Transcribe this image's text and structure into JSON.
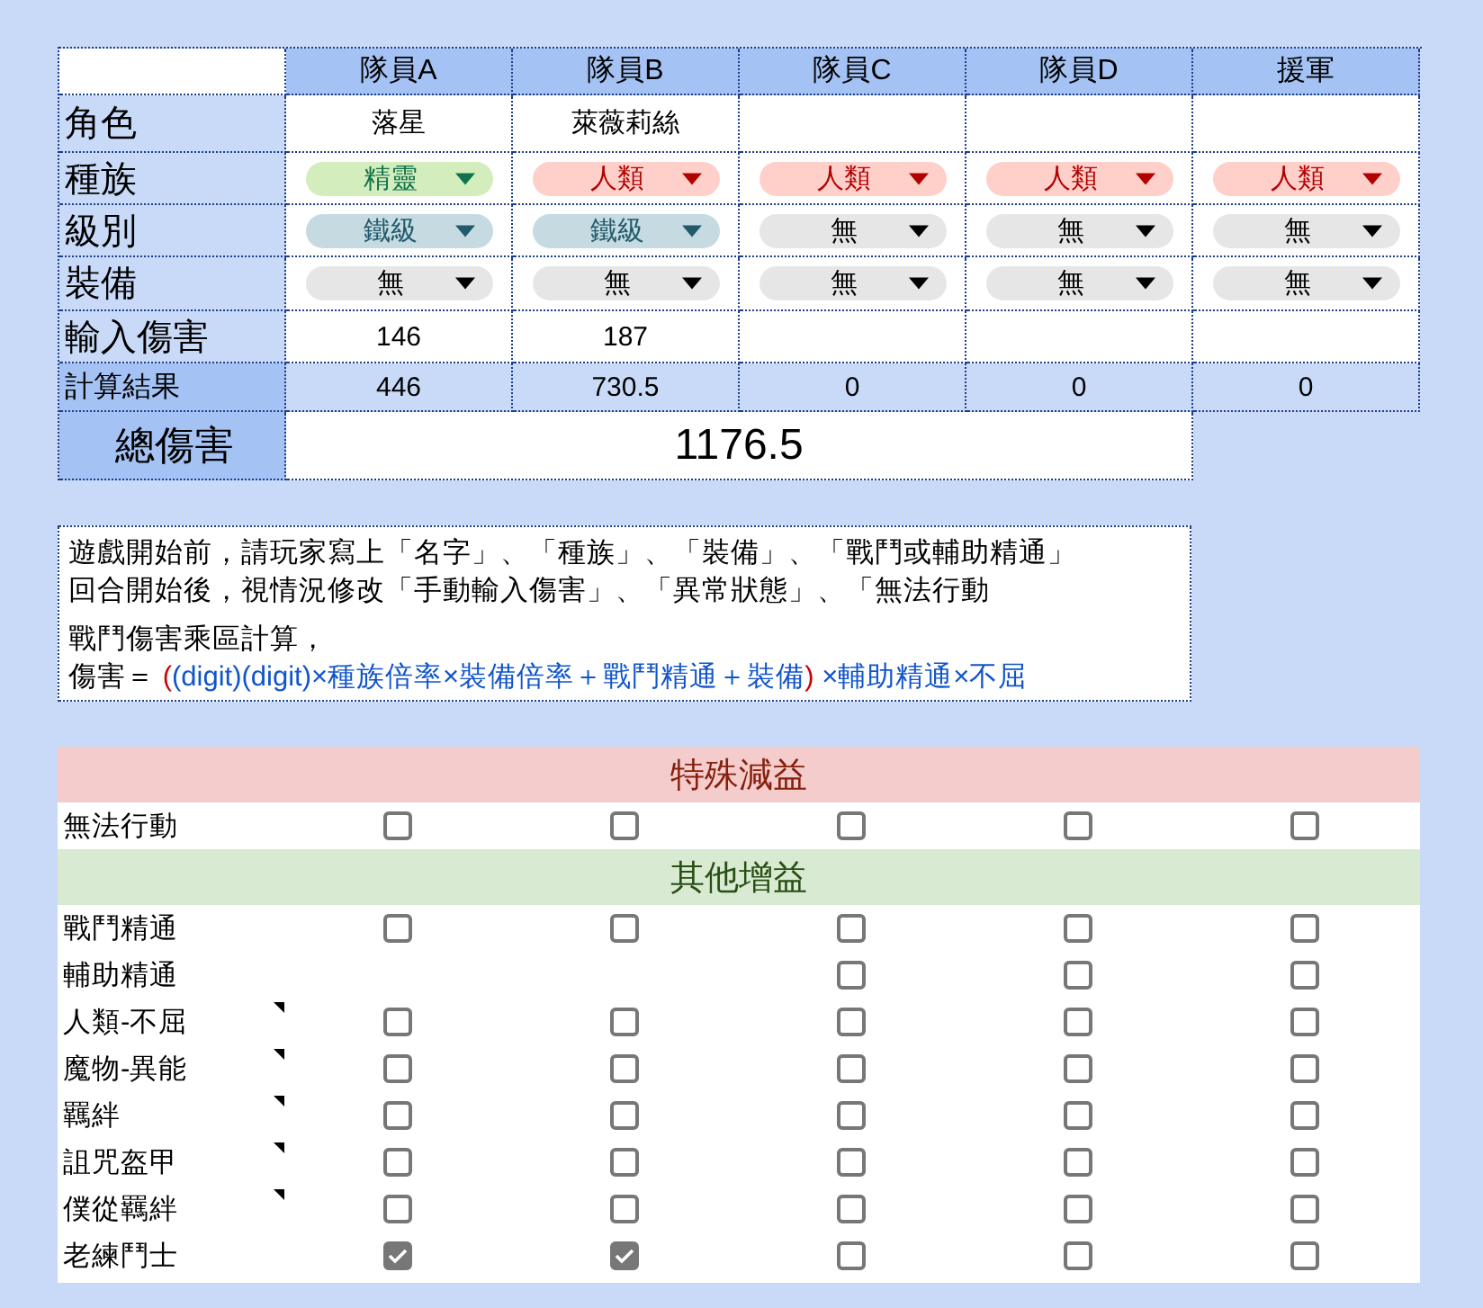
{
  "team_table": {
    "columns": [
      "隊員A",
      "隊員B",
      "隊員C",
      "隊員D",
      "援軍"
    ],
    "rows": [
      {
        "kind": "text",
        "label": "角色",
        "cells": [
          {
            "value": "落星"
          },
          {
            "value": "萊薇莉絲"
          },
          {},
          {},
          {}
        ]
      },
      {
        "kind": "dropdown",
        "label": "種族",
        "cells": [
          {
            "value": "精靈",
            "color": "#d4edbc"
          },
          {
            "value": "人類",
            "color": "#ffcfc9"
          },
          {
            "value": "人類",
            "color": "#ffcfc9"
          },
          {
            "value": "人類",
            "color": "#ffcfc9"
          },
          {
            "value": "人類",
            "color": "#ffcfc9"
          }
        ]
      },
      {
        "kind": "dropdown",
        "label": "級別",
        "cells": [
          {
            "value": "鐵級",
            "color": "#c6dbe1"
          },
          {
            "value": "鐵級",
            "color": "#c6dbe1"
          },
          {
            "value": "無",
            "color": "#e6e6e6"
          },
          {
            "value": "無",
            "color": "#e6e6e6"
          },
          {
            "value": "無",
            "color": "#e6e6e6"
          }
        ]
      },
      {
        "kind": "dropdown",
        "label": "裝備",
        "cells": [
          {
            "value": "無",
            "color": "#e6e6e6"
          },
          {
            "value": "無",
            "color": "#e6e6e6"
          },
          {
            "value": "無",
            "color": "#e6e6e6"
          },
          {
            "value": "無",
            "color": "#e6e6e6"
          },
          {
            "value": "無",
            "color": "#e6e6e6"
          }
        ]
      },
      {
        "kind": "text",
        "label": "輸入傷害",
        "cells": [
          {
            "value": "146"
          },
          {
            "value": "187"
          },
          {},
          {},
          {}
        ]
      },
      {
        "kind": "result",
        "label": "計算結果",
        "cells": [
          {
            "value": "446"
          },
          {
            "value": "730.5"
          },
          {
            "value": "0"
          },
          {
            "value": "0"
          },
          {
            "value": "0"
          }
        ]
      }
    ],
    "total": {
      "label": "總傷害",
      "value": "1176.5"
    }
  },
  "note": {
    "lines": [
      "遊戲開始前，請玩家寫上「名字」、「種族」、「裝備」、「戰鬥或輔助精通」",
      "回合開始後，視情況修改「手動輸入傷害」、「異常狀態」、「無法行動"
    ],
    "formula_intro": "戰鬥傷害乘區計算，",
    "formula": [
      {
        "text": "傷害＝ ",
        "color": "#000000"
      },
      {
        "text": "(",
        "color": "#cc0000"
      },
      {
        "text": "(digit)(digit)×種族倍率×裝備倍率＋戰鬥精通＋裝備",
        "color": "#1155cc"
      },
      {
        "text": ")",
        "color": "#cc0000"
      },
      {
        "text": " ×輔助精通×不屈",
        "color": "#1155cc"
      }
    ]
  },
  "status_table": {
    "rows": [
      {
        "kind": "header",
        "label": "特殊減益",
        "color": "#f4cccc"
      },
      {
        "kind": "checks",
        "label": "無法行動",
        "note": false,
        "cells": [
          {
            "checked": false
          },
          {
            "checked": false
          },
          {
            "checked": false
          },
          {
            "checked": false
          },
          {
            "checked": false
          }
        ]
      },
      {
        "kind": "header",
        "label": "其他增益",
        "color": "#d9ead3"
      },
      {
        "kind": "checks",
        "label": "戰鬥精通",
        "note": false,
        "cells": [
          {
            "checked": false
          },
          {
            "checked": false
          },
          {
            "checked": false
          },
          {
            "checked": false
          },
          {
            "checked": false
          }
        ]
      },
      {
        "kind": "checks",
        "label": "輔助精通",
        "note": false,
        "cells": [
          {},
          {},
          {
            "checked": false
          },
          {
            "checked": false
          },
          {
            "checked": false
          }
        ]
      },
      {
        "kind": "checks",
        "label": "人類-不屈",
        "note": true,
        "cells": [
          {
            "checked": false
          },
          {
            "checked": false
          },
          {
            "checked": false
          },
          {
            "checked": false
          },
          {
            "checked": false
          }
        ]
      },
      {
        "kind": "checks",
        "label": "魔物-異能",
        "note": true,
        "cells": [
          {
            "checked": false
          },
          {
            "checked": false
          },
          {
            "checked": false
          },
          {
            "checked": false
          },
          {
            "checked": false
          }
        ]
      },
      {
        "kind": "checks",
        "label": "羈絆",
        "note": true,
        "cells": [
          {
            "checked": false
          },
          {
            "checked": false
          },
          {
            "checked": false
          },
          {
            "checked": false
          },
          {
            "checked": false
          }
        ]
      },
      {
        "kind": "checks",
        "label": "詛咒盔甲",
        "note": true,
        "cells": [
          {
            "checked": false
          },
          {
            "checked": false
          },
          {
            "checked": false
          },
          {
            "checked": false
          },
          {
            "checked": false
          }
        ]
      },
      {
        "kind": "checks",
        "label": "僕從羈絆",
        "note": true,
        "cells": [
          {
            "checked": false
          },
          {
            "checked": false
          },
          {
            "checked": false
          },
          {
            "checked": false
          },
          {
            "checked": false
          }
        ]
      },
      {
        "kind": "checks",
        "label": "老練鬥士",
        "note": false,
        "cells": [
          {
            "checked": true
          },
          {
            "checked": true
          },
          {
            "checked": false
          },
          {
            "checked": false
          },
          {
            "checked": false
          }
        ]
      }
    ]
  }
}
